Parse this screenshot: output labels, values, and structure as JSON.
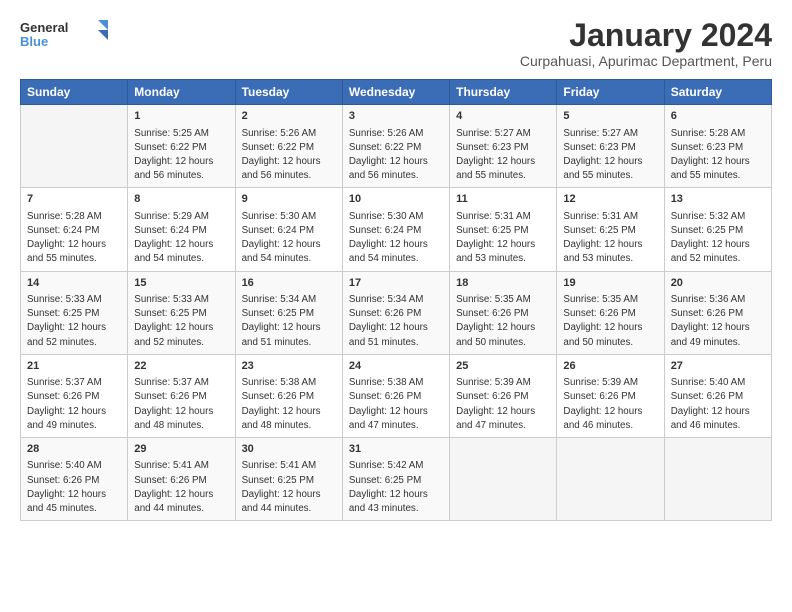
{
  "logo": {
    "general": "General",
    "blue": "Blue"
  },
  "title": "January 2024",
  "subtitle": "Curpahuasi, Apurimac Department, Peru",
  "days_of_week": [
    "Sunday",
    "Monday",
    "Tuesday",
    "Wednesday",
    "Thursday",
    "Friday",
    "Saturday"
  ],
  "weeks": [
    [
      {
        "day": "",
        "info": ""
      },
      {
        "day": "1",
        "info": "Sunrise: 5:25 AM\nSunset: 6:22 PM\nDaylight: 12 hours\nand 56 minutes."
      },
      {
        "day": "2",
        "info": "Sunrise: 5:26 AM\nSunset: 6:22 PM\nDaylight: 12 hours\nand 56 minutes."
      },
      {
        "day": "3",
        "info": "Sunrise: 5:26 AM\nSunset: 6:22 PM\nDaylight: 12 hours\nand 56 minutes."
      },
      {
        "day": "4",
        "info": "Sunrise: 5:27 AM\nSunset: 6:23 PM\nDaylight: 12 hours\nand 55 minutes."
      },
      {
        "day": "5",
        "info": "Sunrise: 5:27 AM\nSunset: 6:23 PM\nDaylight: 12 hours\nand 55 minutes."
      },
      {
        "day": "6",
        "info": "Sunrise: 5:28 AM\nSunset: 6:23 PM\nDaylight: 12 hours\nand 55 minutes."
      }
    ],
    [
      {
        "day": "7",
        "info": "Sunrise: 5:28 AM\nSunset: 6:24 PM\nDaylight: 12 hours\nand 55 minutes."
      },
      {
        "day": "8",
        "info": "Sunrise: 5:29 AM\nSunset: 6:24 PM\nDaylight: 12 hours\nand 54 minutes."
      },
      {
        "day": "9",
        "info": "Sunrise: 5:30 AM\nSunset: 6:24 PM\nDaylight: 12 hours\nand 54 minutes."
      },
      {
        "day": "10",
        "info": "Sunrise: 5:30 AM\nSunset: 6:24 PM\nDaylight: 12 hours\nand 54 minutes."
      },
      {
        "day": "11",
        "info": "Sunrise: 5:31 AM\nSunset: 6:25 PM\nDaylight: 12 hours\nand 53 minutes."
      },
      {
        "day": "12",
        "info": "Sunrise: 5:31 AM\nSunset: 6:25 PM\nDaylight: 12 hours\nand 53 minutes."
      },
      {
        "day": "13",
        "info": "Sunrise: 5:32 AM\nSunset: 6:25 PM\nDaylight: 12 hours\nand 52 minutes."
      }
    ],
    [
      {
        "day": "14",
        "info": "Sunrise: 5:33 AM\nSunset: 6:25 PM\nDaylight: 12 hours\nand 52 minutes."
      },
      {
        "day": "15",
        "info": "Sunrise: 5:33 AM\nSunset: 6:25 PM\nDaylight: 12 hours\nand 52 minutes."
      },
      {
        "day": "16",
        "info": "Sunrise: 5:34 AM\nSunset: 6:25 PM\nDaylight: 12 hours\nand 51 minutes."
      },
      {
        "day": "17",
        "info": "Sunrise: 5:34 AM\nSunset: 6:26 PM\nDaylight: 12 hours\nand 51 minutes."
      },
      {
        "day": "18",
        "info": "Sunrise: 5:35 AM\nSunset: 6:26 PM\nDaylight: 12 hours\nand 50 minutes."
      },
      {
        "day": "19",
        "info": "Sunrise: 5:35 AM\nSunset: 6:26 PM\nDaylight: 12 hours\nand 50 minutes."
      },
      {
        "day": "20",
        "info": "Sunrise: 5:36 AM\nSunset: 6:26 PM\nDaylight: 12 hours\nand 49 minutes."
      }
    ],
    [
      {
        "day": "21",
        "info": "Sunrise: 5:37 AM\nSunset: 6:26 PM\nDaylight: 12 hours\nand 49 minutes."
      },
      {
        "day": "22",
        "info": "Sunrise: 5:37 AM\nSunset: 6:26 PM\nDaylight: 12 hours\nand 48 minutes."
      },
      {
        "day": "23",
        "info": "Sunrise: 5:38 AM\nSunset: 6:26 PM\nDaylight: 12 hours\nand 48 minutes."
      },
      {
        "day": "24",
        "info": "Sunrise: 5:38 AM\nSunset: 6:26 PM\nDaylight: 12 hours\nand 47 minutes."
      },
      {
        "day": "25",
        "info": "Sunrise: 5:39 AM\nSunset: 6:26 PM\nDaylight: 12 hours\nand 47 minutes."
      },
      {
        "day": "26",
        "info": "Sunrise: 5:39 AM\nSunset: 6:26 PM\nDaylight: 12 hours\nand 46 minutes."
      },
      {
        "day": "27",
        "info": "Sunrise: 5:40 AM\nSunset: 6:26 PM\nDaylight: 12 hours\nand 46 minutes."
      }
    ],
    [
      {
        "day": "28",
        "info": "Sunrise: 5:40 AM\nSunset: 6:26 PM\nDaylight: 12 hours\nand 45 minutes."
      },
      {
        "day": "29",
        "info": "Sunrise: 5:41 AM\nSunset: 6:26 PM\nDaylight: 12 hours\nand 44 minutes."
      },
      {
        "day": "30",
        "info": "Sunrise: 5:41 AM\nSunset: 6:25 PM\nDaylight: 12 hours\nand 44 minutes."
      },
      {
        "day": "31",
        "info": "Sunrise: 5:42 AM\nSunset: 6:25 PM\nDaylight: 12 hours\nand 43 minutes."
      },
      {
        "day": "",
        "info": ""
      },
      {
        "day": "",
        "info": ""
      },
      {
        "day": "",
        "info": ""
      }
    ]
  ]
}
